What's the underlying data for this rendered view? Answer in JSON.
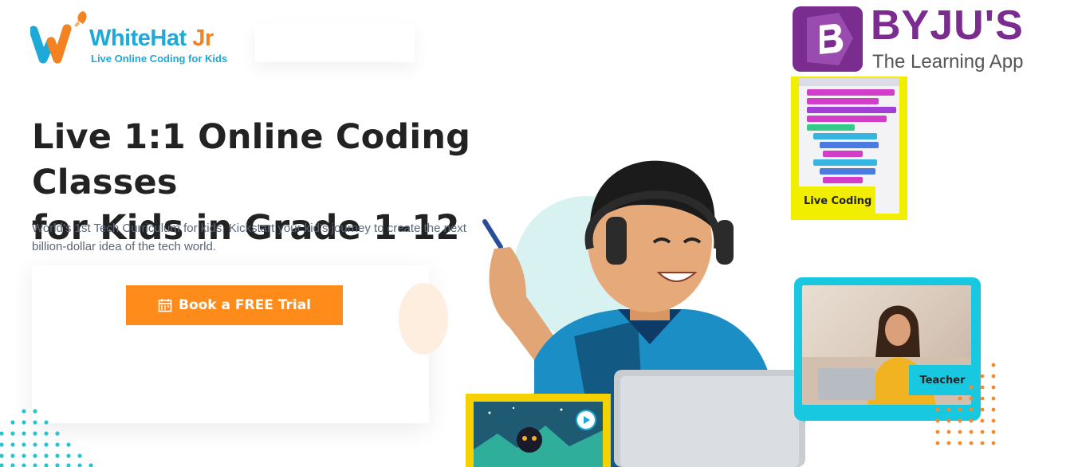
{
  "brand": {
    "name_main": "WhiteHat",
    "name_suffix": "Jr",
    "tagline": "Live Online Coding for Kids",
    "primary_color": "#1ea9d8",
    "accent_color": "#f58220"
  },
  "partner": {
    "name": "BYJU'S",
    "tagline": "The Learning App",
    "color": "#7b2c8f"
  },
  "hero": {
    "headline_line1": "Live 1:1 Online Coding Classes",
    "headline_line2": "for Kids in Grade 1-12",
    "subtext": "World’s 1st Tech Curriculum for kids. Kickstart your kid’s journey to create the next billion-dollar idea of the tech world.",
    "cta_label": "Book a FREE Trial",
    "cta_icon": "calendar-icon",
    "cta_color": "#ff8c1a"
  },
  "panels": {
    "live_coding_label": "Live Coding",
    "teacher_label": "Teacher"
  }
}
